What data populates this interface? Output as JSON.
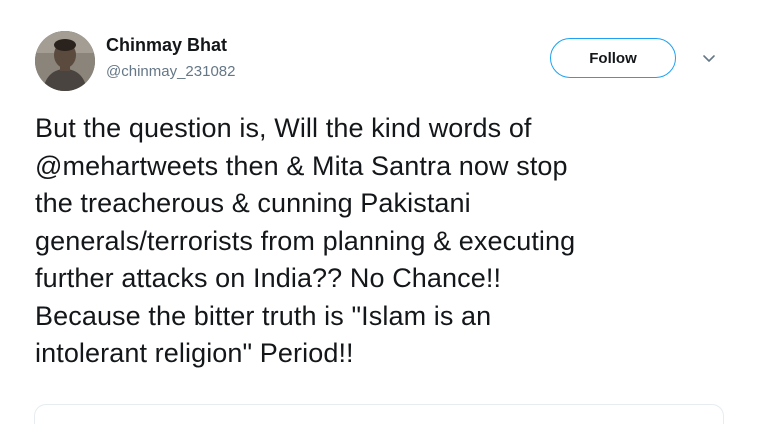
{
  "user": {
    "display_name": "Chinmay Bhat",
    "handle": "@chinmay_231082",
    "avatar_icon": "profile-photo"
  },
  "actions": {
    "follow_label": "Follow",
    "more_icon": "chevron-down-icon"
  },
  "tweet": {
    "lines": [
      "But the question is, Will the kind words of",
      "@mehartweets  then & Mita Santra now stop",
      "the treacherous & cunning Pakistani",
      "generals/terrorists from planning & executing",
      "further attacks on India?? No Chance!!",
      "Because the bitter truth is \"Islam is an",
      "intolerant religion\" Period!!"
    ]
  },
  "colors": {
    "accent": "#1da1f2",
    "text": "#14171a",
    "secondary_text": "#657786"
  }
}
